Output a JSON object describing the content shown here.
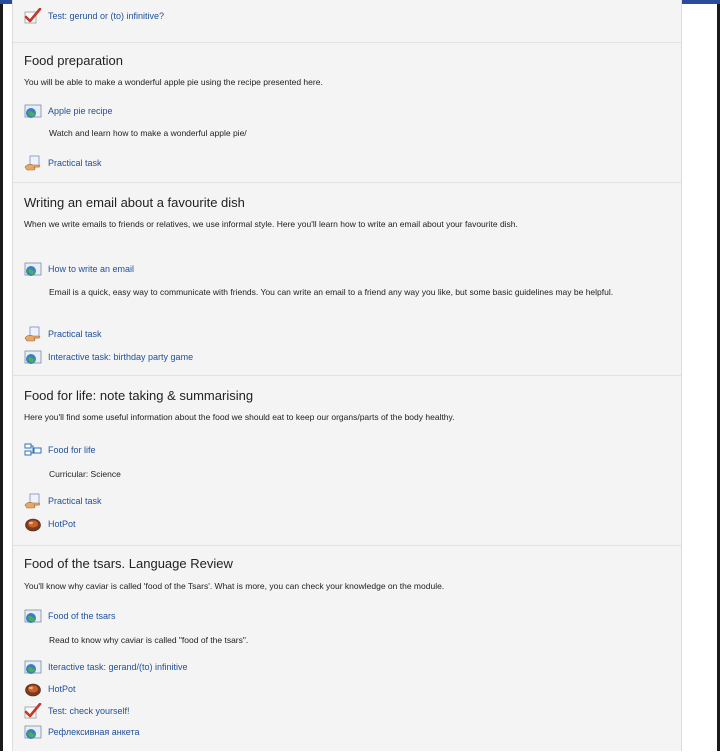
{
  "top_item": {
    "label": "Test: gerund or (to) infinitive?",
    "icon": "checkmark-icon"
  },
  "sections": [
    {
      "title": "Food preparation",
      "description": "You will be able to make a wonderful apple pie using the recipe presented here.",
      "items": [
        {
          "label": "Apple pie recipe",
          "icon": "globe-icon",
          "note": "Watch and learn how to make a wonderful apple pie/"
        },
        {
          "label": "Practical task",
          "icon": "hand-icon"
        }
      ]
    },
    {
      "title": "Writing an email about a favourite dish",
      "description": "When we write emails to friends or relatives, we use informal style. Here you'll learn how to write an email about your favourite dish.",
      "items": [
        {
          "label": "How to write an email",
          "icon": "globe-icon",
          "note": "Email is a quick, easy way to communicate with friends. You can write an email to a friend any way you like, but some basic guidelines may be helpful."
        },
        {
          "label": "Practical task",
          "icon": "hand-icon"
        },
        {
          "label": "Interactive task: birthday party game",
          "icon": "globe-icon"
        }
      ]
    },
    {
      "title": "Food for life: note taking & summarising",
      "description": "Here you'll find some useful information about the food we should eat to keep our organs/parts of the body healthy.",
      "items": [
        {
          "label": "Food for life",
          "icon": "lesson-icon",
          "note": "Curricular: Science"
        },
        {
          "label": "Practical task",
          "icon": "hand-icon"
        },
        {
          "label": "HotPot",
          "icon": "hotpot-icon"
        }
      ]
    },
    {
      "title": "Food of the tsars. Language Review",
      "description": "You'll know why caviar is called 'food of the Tsars'. What is more, you can check your knowledge on the module.",
      "items": [
        {
          "label": "Food of the tsars",
          "icon": "globe-icon",
          "note": "Read to know why caviar is called \"food of the tsars\"."
        },
        {
          "label": "Iteractive task: gerand/(to) infinitive",
          "icon": "globe-icon"
        },
        {
          "label": "HotPot",
          "icon": "hotpot-icon"
        },
        {
          "label": "Test: check yourself!",
          "icon": "checkmark-icon"
        },
        {
          "label": "Рефлексивная анкета",
          "icon": "globe-icon"
        }
      ]
    }
  ]
}
